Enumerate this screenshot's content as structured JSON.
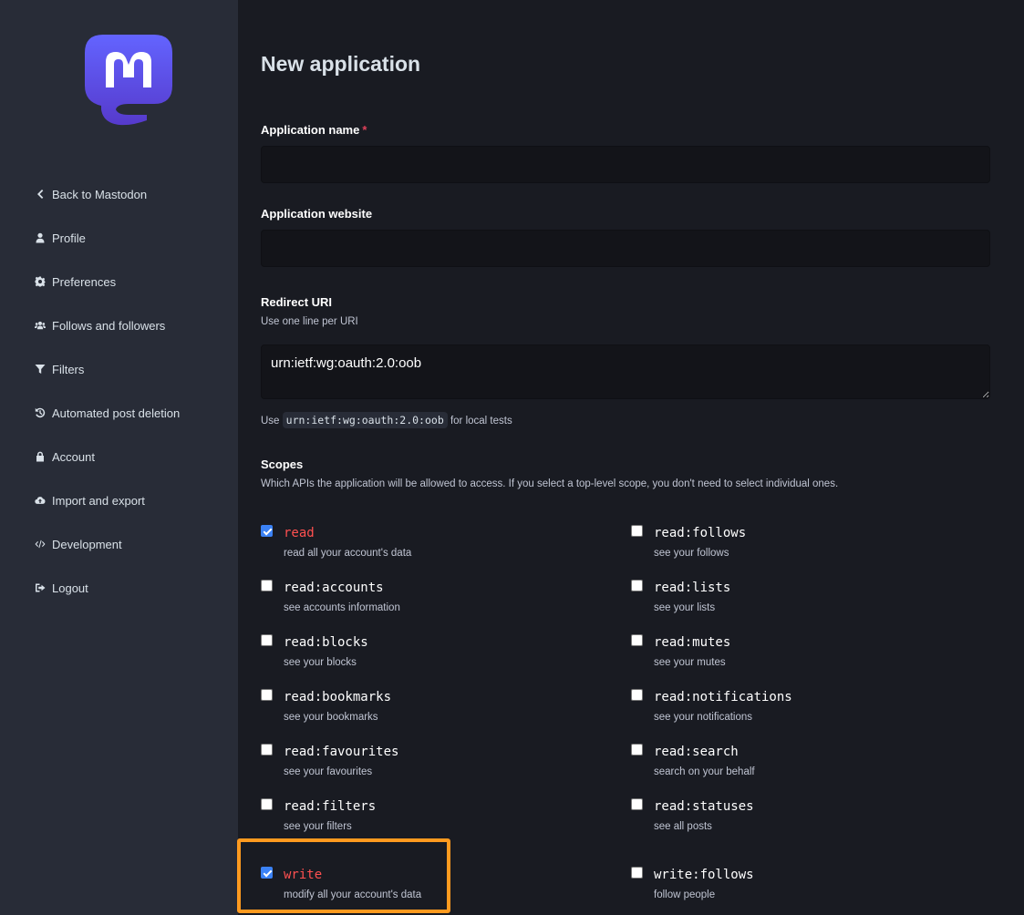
{
  "sidebar": {
    "items": [
      {
        "label": "Back to Mastodon",
        "icon": "chevron-left-icon"
      },
      {
        "label": "Profile",
        "icon": "user-icon"
      },
      {
        "label": "Preferences",
        "icon": "cog-icon"
      },
      {
        "label": "Follows and followers",
        "icon": "users-icon"
      },
      {
        "label": "Filters",
        "icon": "filter-icon"
      },
      {
        "label": "Automated post deletion",
        "icon": "history-icon"
      },
      {
        "label": "Account",
        "icon": "lock-icon"
      },
      {
        "label": "Import and export",
        "icon": "cloud-icon"
      },
      {
        "label": "Development",
        "icon": "code-icon"
      },
      {
        "label": "Logout",
        "icon": "sign-out-icon"
      }
    ]
  },
  "page": {
    "title": "New application"
  },
  "form": {
    "app_name": {
      "label": "Application name",
      "required_mark": "*",
      "value": ""
    },
    "app_website": {
      "label": "Application website",
      "value": ""
    },
    "redirect_uri": {
      "label": "Redirect URI",
      "hint": "Use one line per URI",
      "value": "urn:ietf:wg:oauth:2.0:oob",
      "note_prefix": "Use",
      "note_code": "urn:ietf:wg:oauth:2.0:oob",
      "note_suffix": "for local tests"
    },
    "scopes": {
      "label": "Scopes",
      "hint": "Which APIs the application will be allowed to access. If you select a top-level scope, you don't need to select individual ones.",
      "items": [
        {
          "name": "read",
          "desc": "read all your account's data",
          "checked": true,
          "top_level": true
        },
        {
          "name": "read:follows",
          "desc": "see your follows",
          "checked": false,
          "top_level": false
        },
        {
          "name": "read:accounts",
          "desc": "see accounts information",
          "checked": false,
          "top_level": false
        },
        {
          "name": "read:lists",
          "desc": "see your lists",
          "checked": false,
          "top_level": false
        },
        {
          "name": "read:blocks",
          "desc": "see your blocks",
          "checked": false,
          "top_level": false
        },
        {
          "name": "read:mutes",
          "desc": "see your mutes",
          "checked": false,
          "top_level": false
        },
        {
          "name": "read:bookmarks",
          "desc": "see your bookmarks",
          "checked": false,
          "top_level": false
        },
        {
          "name": "read:notifications",
          "desc": "see your notifications",
          "checked": false,
          "top_level": false
        },
        {
          "name": "read:favourites",
          "desc": "see your favourites",
          "checked": false,
          "top_level": false
        },
        {
          "name": "read:search",
          "desc": "search on your behalf",
          "checked": false,
          "top_level": false
        },
        {
          "name": "read:filters",
          "desc": "see your filters",
          "checked": false,
          "top_level": false
        },
        {
          "name": "read:statuses",
          "desc": "see all posts",
          "checked": false,
          "top_level": false
        },
        {
          "name": "write",
          "desc": "modify all your account's data",
          "checked": true,
          "top_level": true
        },
        {
          "name": "write:follows",
          "desc": "follow people",
          "checked": false,
          "top_level": false
        }
      ]
    }
  },
  "colors": {
    "accent_top_scope": "#ff5050",
    "highlight": "#ff9a1f",
    "brand": "#6364ff"
  }
}
